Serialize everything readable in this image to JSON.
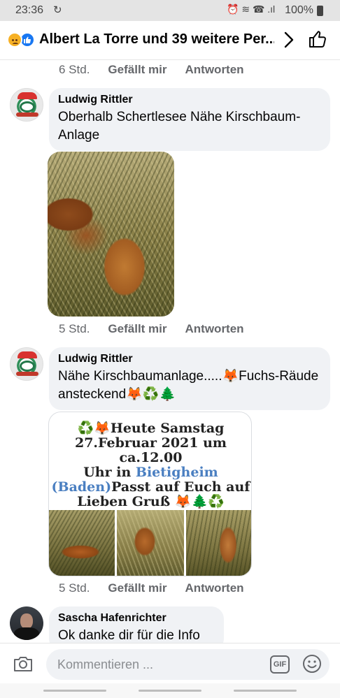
{
  "status_bar": {
    "time": "23:36",
    "sync_glyph": "↻",
    "status_glyphs": "⏰ ≋ ☎ .ıl",
    "battery": "100%"
  },
  "header": {
    "title": "Albert La Torre und 39 weitere Per...",
    "reactions": [
      "sad-face-icon",
      "like-icon"
    ]
  },
  "thread": {
    "top_actions": {
      "time": "6 Std.",
      "like": "Gefällt mir",
      "reply": "Antworten"
    },
    "comments": [
      {
        "author": "Ludwig Rittler",
        "text": "Oberhalb Schertlesee Nähe Kirschbaum-Anlage",
        "time": "5 Std.",
        "like": "Gefällt mir",
        "reply": "Antworten",
        "attachment": "photo"
      },
      {
        "author": "Ludwig Rittler",
        "text": "Nähe Kirschbaumanlage.....🦊Fuchs-Räude ansteckend🦊♻️🌲",
        "time": "5 Std.",
        "like": "Gefällt mir",
        "reply": "Antworten",
        "attachment": {
          "type": "image-card",
          "line1": "♻️🦊Heute Samstag",
          "line2": "27.Februar 2021 um ca.12.00",
          "line3_pre": "Uhr in ",
          "line3_city": "Bietigheim",
          "line4_city": "(Baden)",
          "line4_post": "Passt auf Euch auf",
          "line5": "Lieben Gruß  🦊🌲♻️"
        }
      },
      {
        "author": "Sascha Hafenrichter",
        "text": "Ok danke dir für die Info"
      }
    ]
  },
  "composer": {
    "placeholder": "Kommentieren ...",
    "gif_label": "GIF"
  },
  "colors": {
    "brand_blue": "#1877f2",
    "bubble_bg": "#f0f2f5",
    "secondary_text": "#65676b",
    "city_blue": "#4a7fc1"
  }
}
